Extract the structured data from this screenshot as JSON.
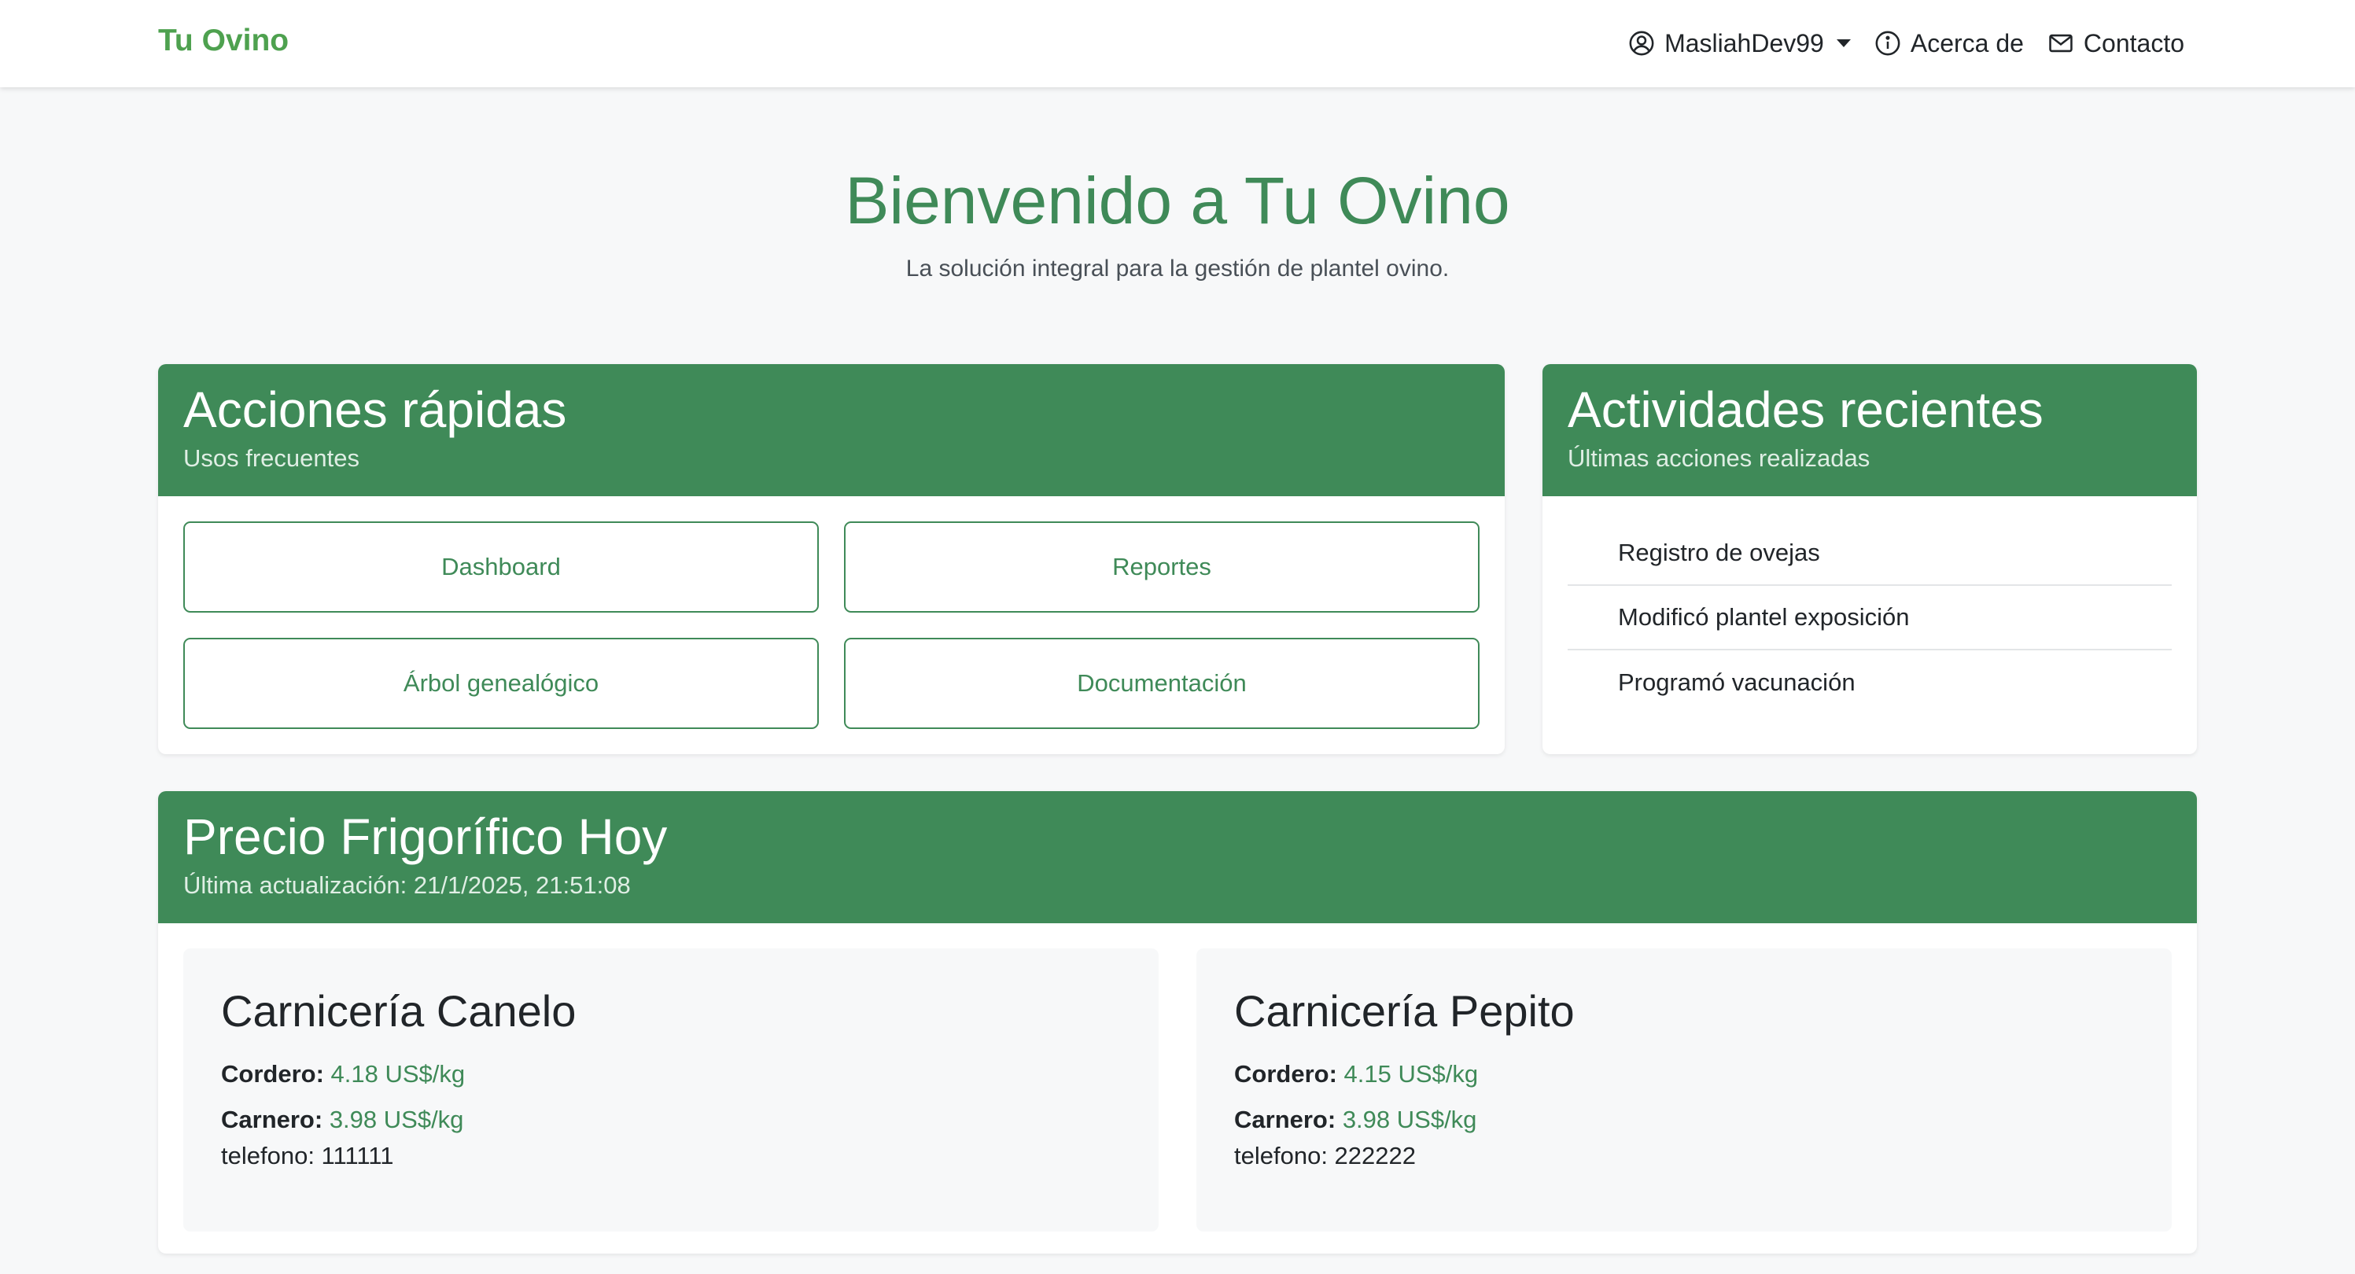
{
  "nav": {
    "brand": "Tu Ovino",
    "user": "MasliahDev99",
    "about": "Acerca de",
    "contact": "Contacto"
  },
  "hero": {
    "title": "Bienvenido a Tu Ovino",
    "subtitle": "La solución integral para la gestión de plantel ovino."
  },
  "quick_actions": {
    "title": "Acciones rápidas",
    "subtitle": "Usos frecuentes",
    "buttons": [
      "Dashboard",
      "Reportes",
      "Árbol genealógico",
      "Documentación"
    ]
  },
  "recent": {
    "title": "Actividades recientes",
    "subtitle": "Últimas acciones realizadas",
    "items": [
      "Registro de ovejas",
      "Modificó plantel exposición",
      "Programó vacunación"
    ]
  },
  "price": {
    "title": "Precio Frigorífico Hoy",
    "subtitle": "Última actualización: 21/1/2025, 21:51:08",
    "shops": [
      {
        "name": "Carnicería Canelo",
        "cordero_label": "Cordero:",
        "cordero_value": "4.18 US$/kg",
        "carnero_label": "Carnero:",
        "carnero_value": "3.98 US$/kg",
        "phone": "telefono: 111111"
      },
      {
        "name": "Carnicería Pepito",
        "cordero_label": "Cordero:",
        "cordero_value": "4.15 US$/kg",
        "carnero_label": "Carnero:",
        "carnero_value": "3.98 US$/kg",
        "phone": "telefono: 222222"
      }
    ]
  },
  "colors": {
    "brand": "#4ea14f",
    "primary": "#3f8a58",
    "background": "#f7f8f9"
  }
}
